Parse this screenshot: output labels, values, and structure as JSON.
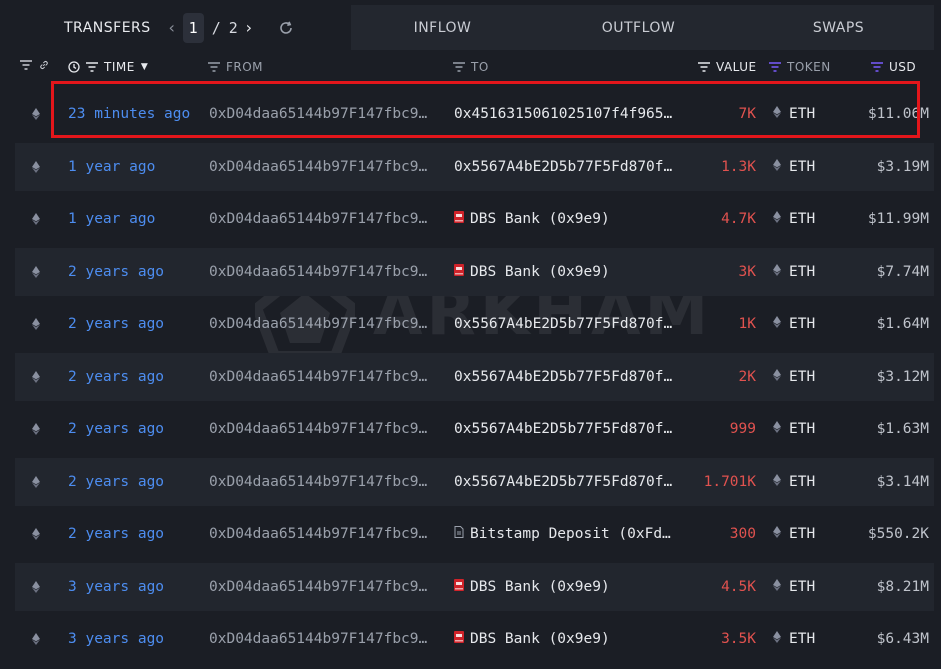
{
  "tabs": {
    "transfers": "TRANSFERS",
    "inflow": "INFLOW",
    "outflow": "OUTFLOW",
    "swaps": "SWAPS"
  },
  "pager": {
    "current": "1",
    "separator": "/",
    "total": "2"
  },
  "columns": {
    "time": "TIME",
    "from": "FROM",
    "to": "TO",
    "value": "VALUE",
    "token": "TOKEN",
    "usd": "USD"
  },
  "watermark": "ARKHAM",
  "colors": {
    "link": "#4d8df0",
    "negative": "#e0524f",
    "highlight": "#e3161b",
    "accent": "#7b5cff"
  },
  "rows": [
    {
      "time": "23 minutes ago",
      "from": "0xD04daa65144b97F147fbc9…",
      "to": "0x4516315061025107f4f965…",
      "to_icon": "",
      "value": "7K",
      "token": "ETH",
      "usd": "$11.06M"
    },
    {
      "time": "1 year ago",
      "from": "0xD04daa65144b97F147fbc9…",
      "to": "0x5567A4bE2D5b77F5Fd870f…",
      "to_icon": "",
      "value": "1.3K",
      "token": "ETH",
      "usd": "$3.19M"
    },
    {
      "time": "1 year ago",
      "from": "0xD04daa65144b97F147fbc9…",
      "to": "DBS Bank (0x9e9)",
      "to_icon": "bank-icon",
      "value": "4.7K",
      "token": "ETH",
      "usd": "$11.99M"
    },
    {
      "time": "2 years ago",
      "from": "0xD04daa65144b97F147fbc9…",
      "to": "DBS Bank (0x9e9)",
      "to_icon": "bank-icon",
      "value": "3K",
      "token": "ETH",
      "usd": "$7.74M"
    },
    {
      "time": "2 years ago",
      "from": "0xD04daa65144b97F147fbc9…",
      "to": "0x5567A4bE2D5b77F5Fd870f…",
      "to_icon": "",
      "value": "1K",
      "token": "ETH",
      "usd": "$1.64M"
    },
    {
      "time": "2 years ago",
      "from": "0xD04daa65144b97F147fbc9…",
      "to": "0x5567A4bE2D5b77F5Fd870f…",
      "to_icon": "",
      "value": "2K",
      "token": "ETH",
      "usd": "$3.12M"
    },
    {
      "time": "2 years ago",
      "from": "0xD04daa65144b97F147fbc9…",
      "to": "0x5567A4bE2D5b77F5Fd870f…",
      "to_icon": "",
      "value": "999",
      "token": "ETH",
      "usd": "$1.63M"
    },
    {
      "time": "2 years ago",
      "from": "0xD04daa65144b97F147fbc9…",
      "to": "0x5567A4bE2D5b77F5Fd870f…",
      "to_icon": "",
      "value": "1.701K",
      "token": "ETH",
      "usd": "$3.14M"
    },
    {
      "time": "2 years ago",
      "from": "0xD04daa65144b97F147fbc9…",
      "to": "Bitstamp Deposit (0xFd…",
      "to_icon": "document-icon",
      "value": "300",
      "token": "ETH",
      "usd": "$550.2K"
    },
    {
      "time": "3 years ago",
      "from": "0xD04daa65144b97F147fbc9…",
      "to": "DBS Bank (0x9e9)",
      "to_icon": "bank-icon",
      "value": "4.5K",
      "token": "ETH",
      "usd": "$8.21M"
    },
    {
      "time": "3 years ago",
      "from": "0xD04daa65144b97F147fbc9…",
      "to": "DBS Bank (0x9e9)",
      "to_icon": "bank-icon",
      "value": "3.5K",
      "token": "ETH",
      "usd": "$6.43M"
    }
  ]
}
